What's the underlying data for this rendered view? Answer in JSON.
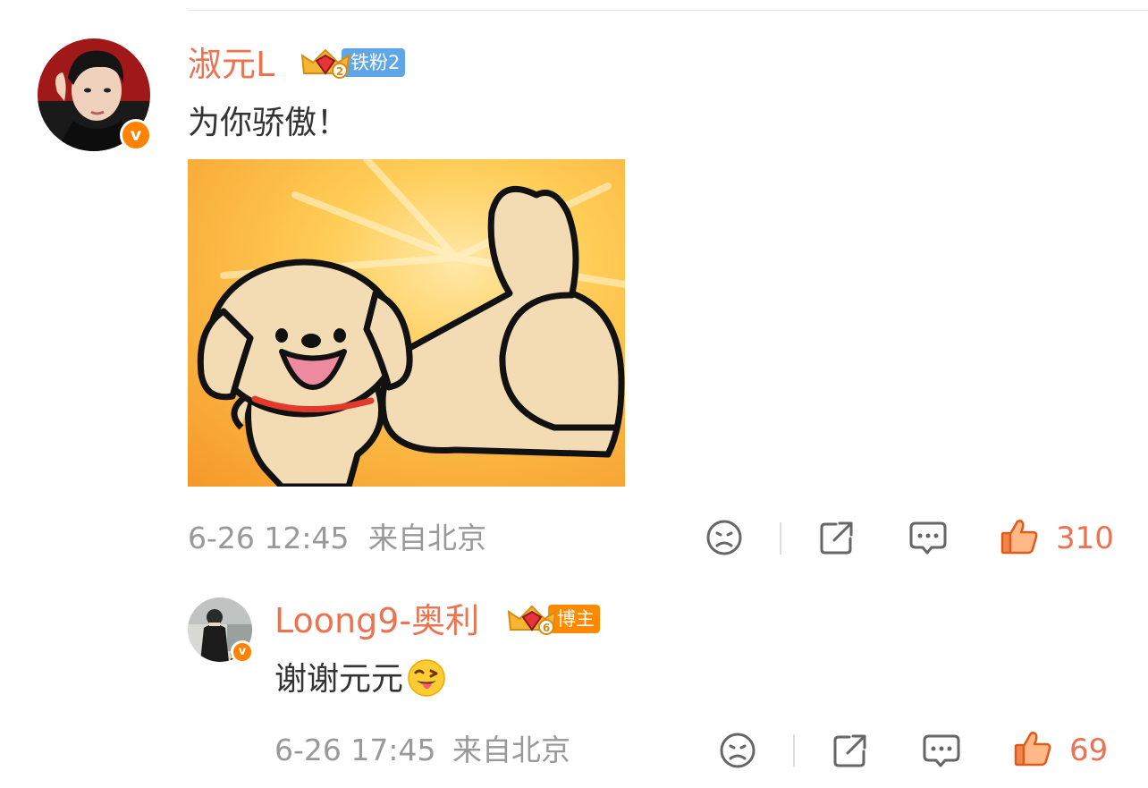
{
  "comment": {
    "username": "淑元L",
    "fan_badge_label": "铁粉2",
    "fan_level": "2",
    "text": "为你骄傲！",
    "image_alt": "dog-thumbs-up-sticker",
    "timestamp": "6-26 12:45",
    "location": "来自北京",
    "like_count": "310",
    "username_color": "#eb7350",
    "badge_color": "#5fa6e8"
  },
  "reply": {
    "username": "Loong9-奥利",
    "fan_badge_label": "博主",
    "fan_level": "6",
    "text": "谢谢元元",
    "emoji": "grinning-tongue-emoji",
    "timestamp": "6-26 17:45",
    "location": "来自北京",
    "like_count": "69",
    "badge_color": "#ff8a00"
  },
  "icons": {
    "dislike": "sad-face-icon",
    "share": "share-icon",
    "reply": "comment-bubble-icon",
    "like": "thumbs-up-icon",
    "verified": "v-verified-icon"
  },
  "colors": {
    "accent": "#eb7350",
    "meta": "#999999",
    "verified": "#ff8200"
  }
}
